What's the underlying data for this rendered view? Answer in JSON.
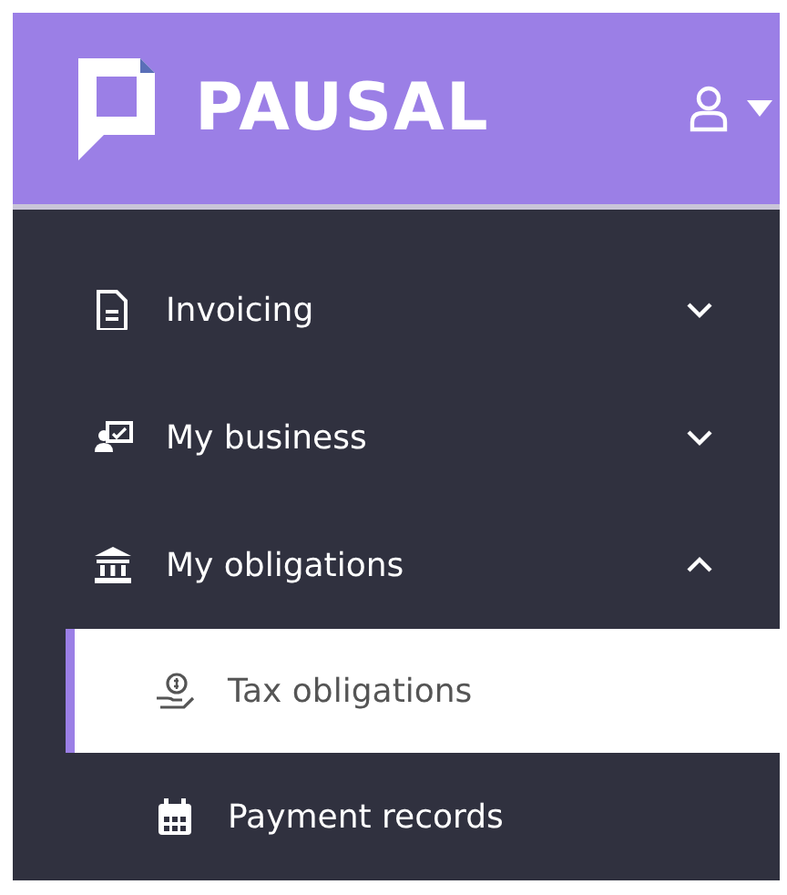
{
  "header": {
    "logo_text": "PAUSAL"
  },
  "nav": [
    {
      "label": "Invoicing",
      "expanded": false
    },
    {
      "label": "My business",
      "expanded": false
    },
    {
      "label": "My obligations",
      "expanded": true,
      "children": [
        {
          "label": "Tax obligations",
          "selected": true
        },
        {
          "label": "Payment records",
          "selected": false
        }
      ]
    }
  ]
}
